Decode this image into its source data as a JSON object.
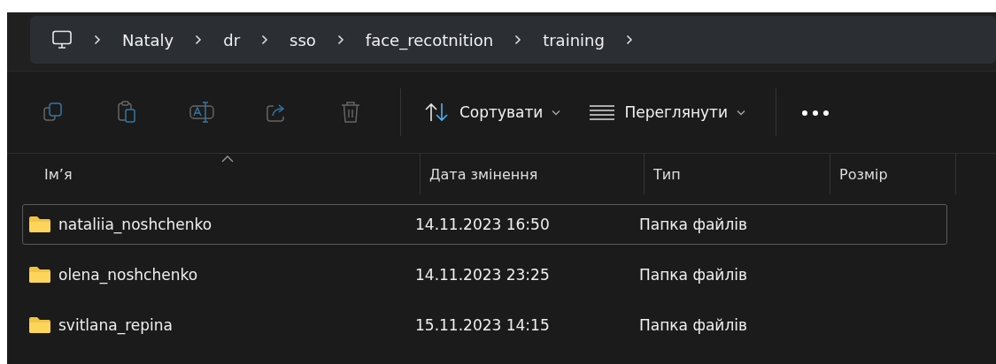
{
  "breadcrumb": {
    "items": [
      "Nataly",
      "dr",
      "sso",
      "face_recotnition",
      "training"
    ]
  },
  "toolbar": {
    "actions": [
      {
        "kind": "copy",
        "disabled": true
      },
      {
        "kind": "paste",
        "disabled": true
      },
      {
        "kind": "rename",
        "disabled": true
      },
      {
        "kind": "share",
        "disabled": true
      },
      {
        "kind": "delete",
        "disabled": true
      }
    ],
    "sort_button": "Сортувати",
    "view_button": "Переглянути"
  },
  "table": {
    "columns": [
      {
        "label": "Ім’я",
        "sorted": true
      },
      {
        "label": "Дата змінення",
        "sorted": false
      },
      {
        "label": "Тип",
        "sorted": false
      },
      {
        "label": "Розмір",
        "sorted": false
      }
    ],
    "rows": [
      {
        "name": "nataliia_noshchenko",
        "date": "14.11.2023 16:50",
        "type": "Папка файлів",
        "selected": true
      },
      {
        "name": "olena_noshchenko",
        "date": "14.11.2023 23:25",
        "type": "Папка файлів",
        "selected": false
      },
      {
        "name": "svitlana_repina",
        "date": "15.11.2023 14:15",
        "type": "Папка файлів",
        "selected": false
      }
    ]
  }
}
